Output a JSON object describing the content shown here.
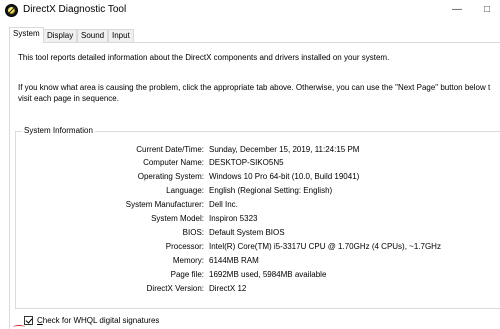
{
  "window": {
    "title": "DirectX Diagnostic Tool",
    "minimize_glyph": "—",
    "maximize_glyph": "□"
  },
  "tabs": [
    {
      "label": "System",
      "active": true
    },
    {
      "label": "Display",
      "active": false
    },
    {
      "label": "Sound",
      "active": false
    },
    {
      "label": "Input",
      "active": false
    }
  ],
  "intro": {
    "line1": "This tool reports detailed information about the DirectX components and drivers installed on your system.",
    "line2a": "If you know what area is causing the problem, click the appropriate tab above.  Otherwise, you can use the \"Next Page\" button below t",
    "line2b": "visit each page in sequence."
  },
  "system_information": {
    "group_label": "System Information",
    "rows": [
      {
        "label": "Current Date/Time:",
        "value": "Sunday, December 15, 2019, 11:24:15 PM"
      },
      {
        "label": "Computer Name:",
        "value": "DESKTOP-SIKO5N5"
      },
      {
        "label": "Operating System:",
        "value": "Windows 10 Pro 64-bit (10.0, Build 19041)"
      },
      {
        "label": "Language:",
        "value": "English (Regional Setting: English)"
      },
      {
        "label": "System Manufacturer:",
        "value": "Dell Inc."
      },
      {
        "label": "System Model:",
        "value": "Inspiron 5323"
      },
      {
        "label": "BIOS:",
        "value": "Default System BIOS"
      },
      {
        "label": "Processor:",
        "value": "Intel(R) Core(TM) i5-3317U CPU @ 1.70GHz (4 CPUs), ~1.7GHz"
      },
      {
        "label": "Memory:",
        "value": "6144MB RAM"
      },
      {
        "label": "Page file:",
        "value": "1692MB used, 5984MB available"
      },
      {
        "label": "DirectX Version:",
        "value": "DirectX 12"
      }
    ]
  },
  "whql": {
    "checked": true,
    "label_underlined": "C",
    "label_rest": "heck for WHQL digital signatures"
  }
}
